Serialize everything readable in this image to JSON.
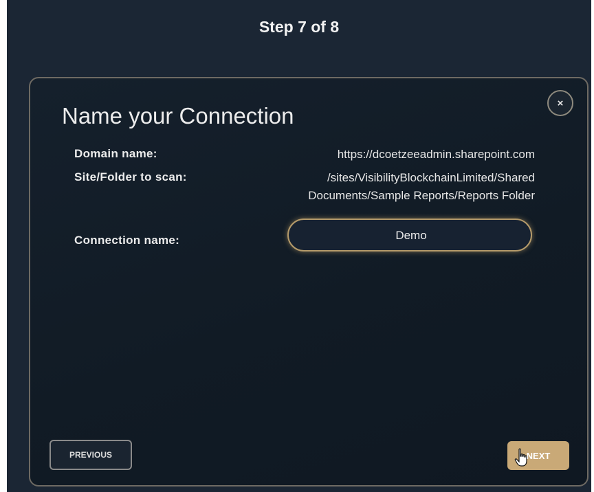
{
  "header": {
    "step_label": "Step 7 of 8"
  },
  "dialog": {
    "title": "Name your Connection",
    "close_label": "×",
    "fields": {
      "domain": {
        "label": "Domain name:",
        "value": "https://dcoetzeeadmin.sharepoint.com"
      },
      "site": {
        "label": "Site/Folder to scan:",
        "value_line1": "/sites/VisibilityBlockchainLimited/Shared",
        "value_line2": "Documents/Sample Reports/Reports Folder"
      },
      "connection_name": {
        "label": "Connection name:",
        "value": "Demo"
      }
    },
    "buttons": {
      "previous": "PREVIOUS",
      "next": "NEXT"
    }
  },
  "colors": {
    "background": "#1b2634",
    "dialog": "#111b25",
    "accent": "#c9a977"
  },
  "icons": {
    "close": "close-icon",
    "cursor": "hand-cursor-icon"
  }
}
